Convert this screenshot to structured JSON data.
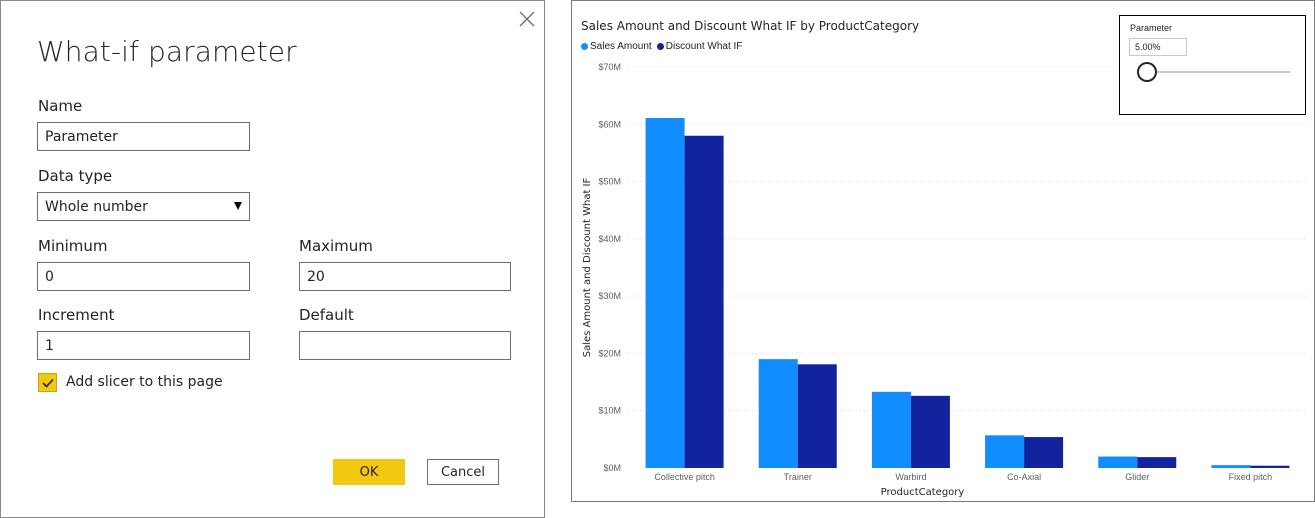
{
  "dialog": {
    "title": "What-if parameter",
    "name_label": "Name",
    "name_value": "Parameter",
    "datatype_label": "Data type",
    "datatype_value": "Whole number",
    "minimum_label": "Minimum",
    "minimum_value": "0",
    "maximum_label": "Maximum",
    "maximum_value": "20",
    "increment_label": "Increment",
    "increment_value": "1",
    "default_label": "Default",
    "default_value": "",
    "checkbox_label": "Add slicer to this page",
    "checkbox_checked": true,
    "ok_label": "OK",
    "cancel_label": "Cancel"
  },
  "slicer": {
    "title": "Parameter",
    "value": "5.00%",
    "level": 0.0
  },
  "colors": {
    "accent_yellow": "#F2C811",
    "sales_amount": "#118DFF",
    "discount_whatif": "#12239E"
  },
  "chart_data": {
    "type": "bar",
    "title": "Sales Amount and Discount What IF by ProductCategory",
    "xlabel": "ProductCategory",
    "ylabel": "Sales Amount and Discount What IF",
    "categories": [
      "Collective pitch",
      "Trainer",
      "Warbird",
      "Co-Axial",
      "Glider",
      "Fixed pitch"
    ],
    "series": [
      {
        "name": "Sales Amount",
        "values": [
          61.1,
          19.0,
          13.3,
          5.7,
          2.0,
          0.5
        ]
      },
      {
        "name": "Discount What IF",
        "values": [
          58.0,
          18.1,
          12.6,
          5.4,
          1.9,
          0.4
        ]
      }
    ],
    "ylim": [
      0,
      70
    ],
    "yticks": [
      "$0M",
      "$10M",
      "$20M",
      "$30M",
      "$40M",
      "$50M",
      "$60M",
      "$70M"
    ],
    "grid": true,
    "legend_position": "top-left"
  }
}
